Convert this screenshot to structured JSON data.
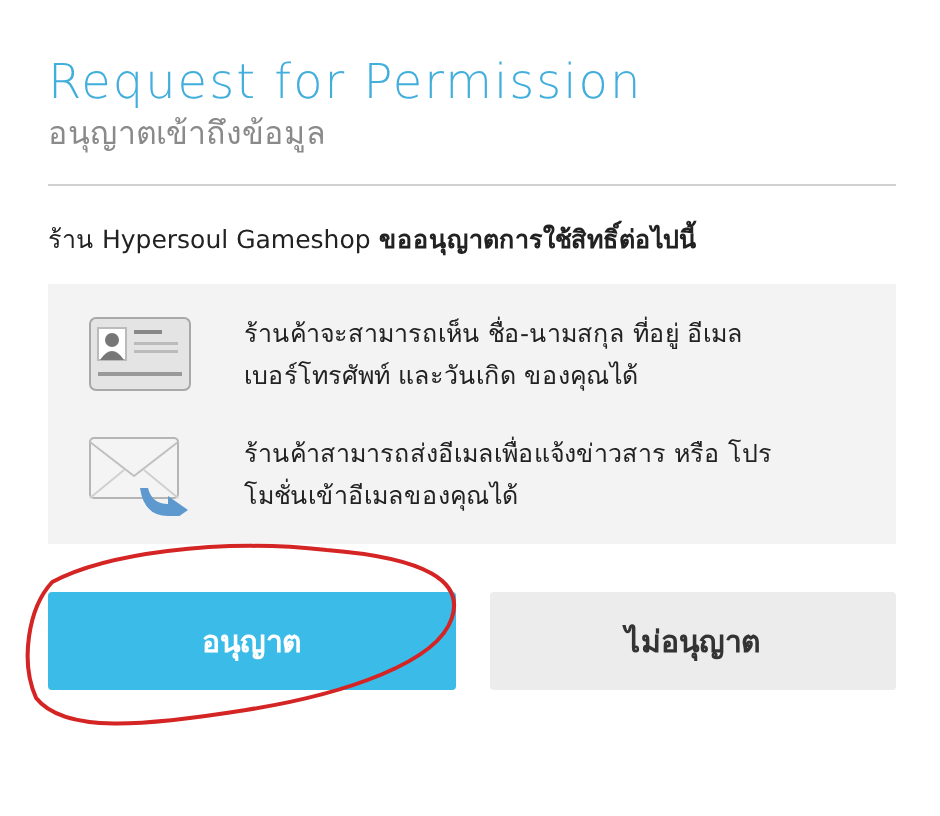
{
  "header": {
    "title": "Request for Permission",
    "subtitle": "อนุญาตเข้าถึงข้อมูล"
  },
  "request": "ร้าน Hypersoul Gameshop **ขออนุญาตการใช้สิทธิ์ต่อไปนี้**",
  "permissions": [
    {
      "kind": "profile",
      "text": "ร้านค้าจะสามารถเห็น ชื่อ-นามสกุล ที่อยู่ อีเมล เบอร์โทรศัพท์ และวันเกิด ของคุณได้"
    },
    {
      "kind": "email",
      "text": "ร้านค้าสามารถส่งอีเมลเพื่อแจ้งข่าวสาร หรือ โปรโมชั่นเข้าอีเมลของคุณได้"
    }
  ],
  "buttons": [
    {
      "label": "อนุญาต",
      "kind": "primary",
      "circled": true
    },
    {
      "label": "ไม่อนุญาต",
      "kind": "secondary",
      "circled": false
    }
  ]
}
